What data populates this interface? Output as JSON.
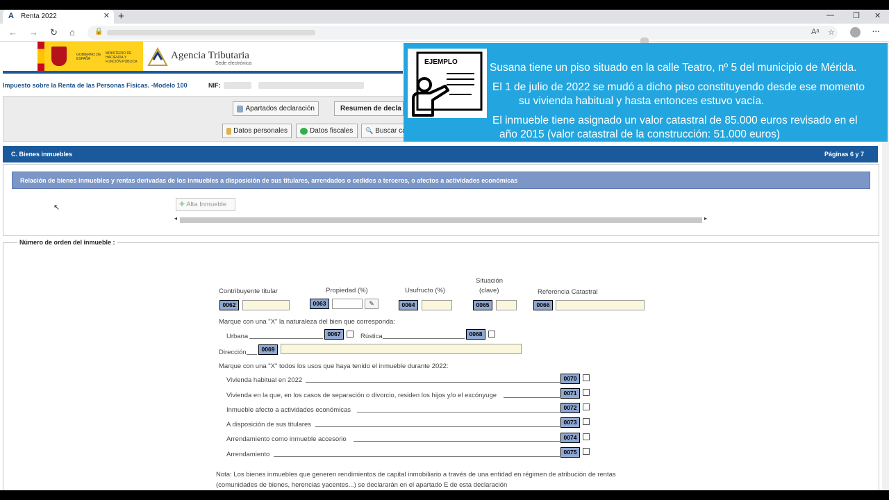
{
  "browser": {
    "tab_title": "Renta 2022",
    "url": ""
  },
  "header": {
    "gov_line1": "GOBIERNO DE ESPAÑA",
    "gov_line2": "MINISTERIO DE HACIENDA Y FUNCIÓN PÚBLICA",
    "agency_name": "Agencia Tributaria",
    "agency_sub": "Sede electrónica",
    "model_line": "Impuesto sobre la Renta de las Personas Físicas. -Modelo 100",
    "nif_label": "NIF:",
    "nif_value": ""
  },
  "toolbar": {
    "apartados": "Apartados declaración",
    "resumen": "Resumen de decla",
    "datos_personales": "Datos personales",
    "datos_fiscales": "Datos fiscales",
    "buscar": "Buscar ca"
  },
  "section": {
    "title": "C.  Bienes inmuebles",
    "pages": "Páginas 6 y 7",
    "relation_header": "Relación de bienes inmuebles y rentas derivadas de los inmuebles a disposición de sus titulares, arrendados o cedidos a terceros, o afectos a actividades económicas",
    "alta_button": "Alta Inmueble"
  },
  "form": {
    "legend": "Número de orden del inmueble :",
    "contribuyente_label": "Contribuyente titular",
    "propiedad_label": "Propiedad (%)",
    "usufructo_label": "Usufructo (%)",
    "situacion_label1": "Situación",
    "situacion_label2": "(clave)",
    "referencia_label": "Referencia Catastral",
    "codes": {
      "c0062": "0062",
      "c0063": "0063",
      "c0064": "0064",
      "c0065": "0065",
      "c0066": "0066",
      "c0067": "0067",
      "c0068": "0068",
      "c0069": "0069",
      "c0070": "0070",
      "c0071": "0071",
      "c0072": "0072",
      "c0073": "0073",
      "c0074": "0074",
      "c0075": "0075"
    },
    "naturaleza_text": "Marque con una \"X\" la naturaleza del bien que corresponda:",
    "urbana_label": "Urbana",
    "rustica_label": "Rústica",
    "direccion_label": "Dirección",
    "usos_text": "Marque con una \"X\" todos los usos que haya tenido el inmueble durante 2022:",
    "usos": [
      "Vivienda habitual en 2022",
      "Vivienda en la que, en los casos de separación o divorcio, residen los hijos y/o el excónyuge",
      "Inmueble afecto a actividades económicas",
      "A disposición de sus titulares",
      "Arrendamiento como inmueble accesorio",
      "Arrendamiento"
    ],
    "nota_line1": "Nota: Los bienes inmuebles que generen rendimientos de capital inmobiliario a través de una entidad en régimen de atribución de rentas",
    "nota_line2": "(comunidades de bienes, herencias yacentes...) se declararán en el apartado E de esta declaración"
  },
  "example": {
    "badge": "EJEMPLO",
    "line1": "Susana tiene un piso situado en la calle Teatro, nº 5 del municipio de Mérida.",
    "line2": "El 1 de julio de 2022 se mudó a dicho piso constituyendo desde ese momento",
    "line3": "su vivienda habitual y hasta entonces estuvo vacía.",
    "line4": "El inmueble tiene asignado un valor catastral de 85.000 euros revisado en el",
    "line5": "año 2015 (valor catastral de la construcción: 51.000 euros)",
    "background_color": "#23a6df"
  },
  "icons": [
    "back-icon",
    "forward-icon",
    "reload-icon",
    "home-icon",
    "lock-icon",
    "read-aloud-icon",
    "favorites-icon",
    "profile-icon",
    "more-icon",
    "pencil-icon",
    "example-icon"
  ]
}
